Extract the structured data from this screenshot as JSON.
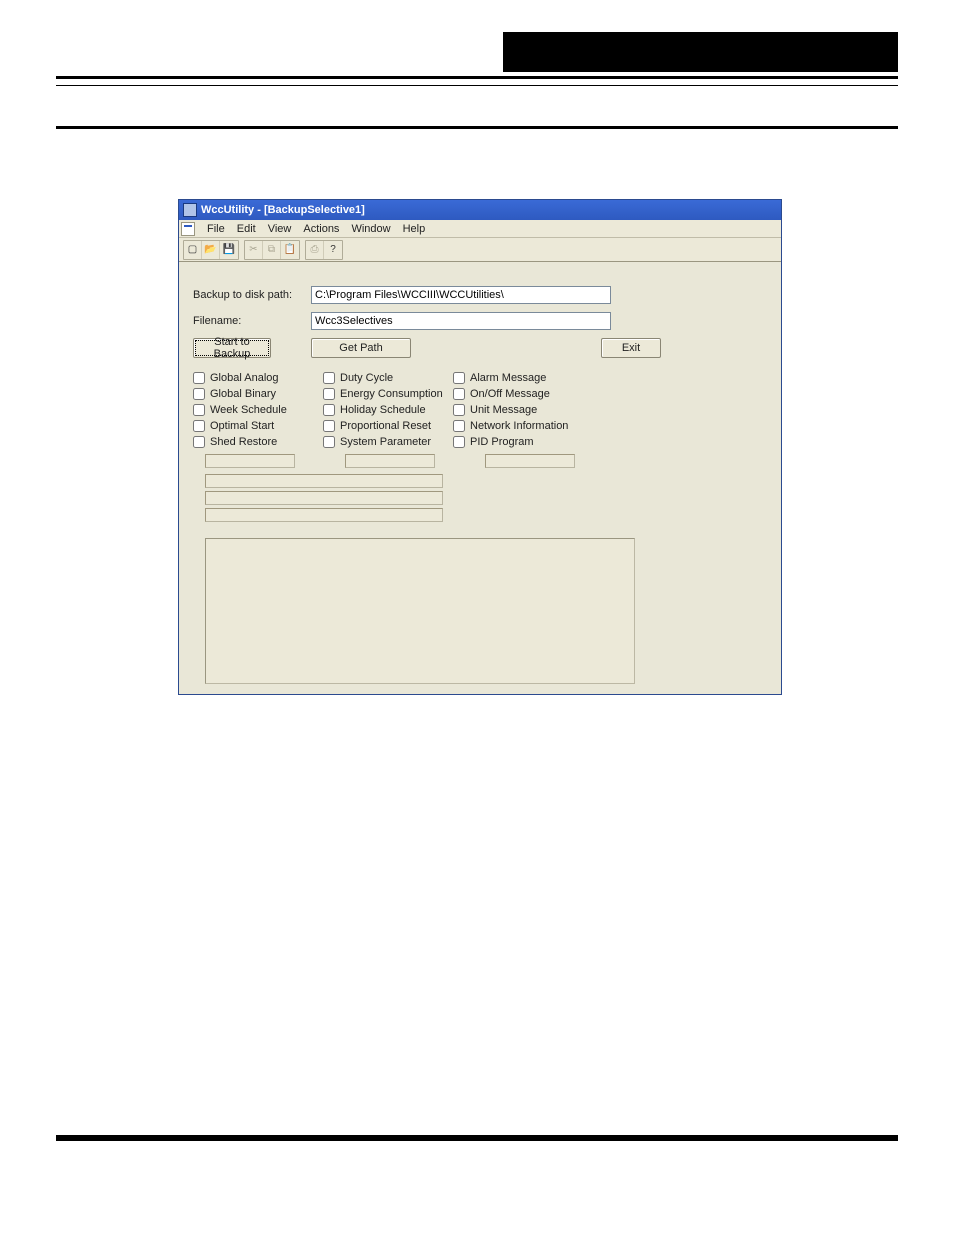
{
  "window": {
    "title": "WccUtility - [BackupSelective1]",
    "menu": [
      "File",
      "Edit",
      "View",
      "Actions",
      "Window",
      "Help"
    ]
  },
  "form": {
    "path_label": "Backup to disk path:",
    "path_value": "C:\\Program Files\\WCCIII\\WCCUtilities\\",
    "filename_label": "Filename:",
    "filename_value": "Wcc3Selectives",
    "start_label": "Start to Backup",
    "getpath_label": "Get Path",
    "exit_label": "Exit"
  },
  "checkboxes": {
    "col1": [
      "Global Analog",
      "Global Binary",
      "Week Schedule",
      "Optimal Start",
      "Shed Restore"
    ],
    "col2": [
      "Duty Cycle",
      "Energy Consumption",
      "Holiday Schedule",
      "Proportional Reset",
      "System Parameter"
    ],
    "col3": [
      "Alarm Message",
      "On/Off Message",
      "Unit Message",
      "Network Information",
      "PID Program"
    ]
  }
}
